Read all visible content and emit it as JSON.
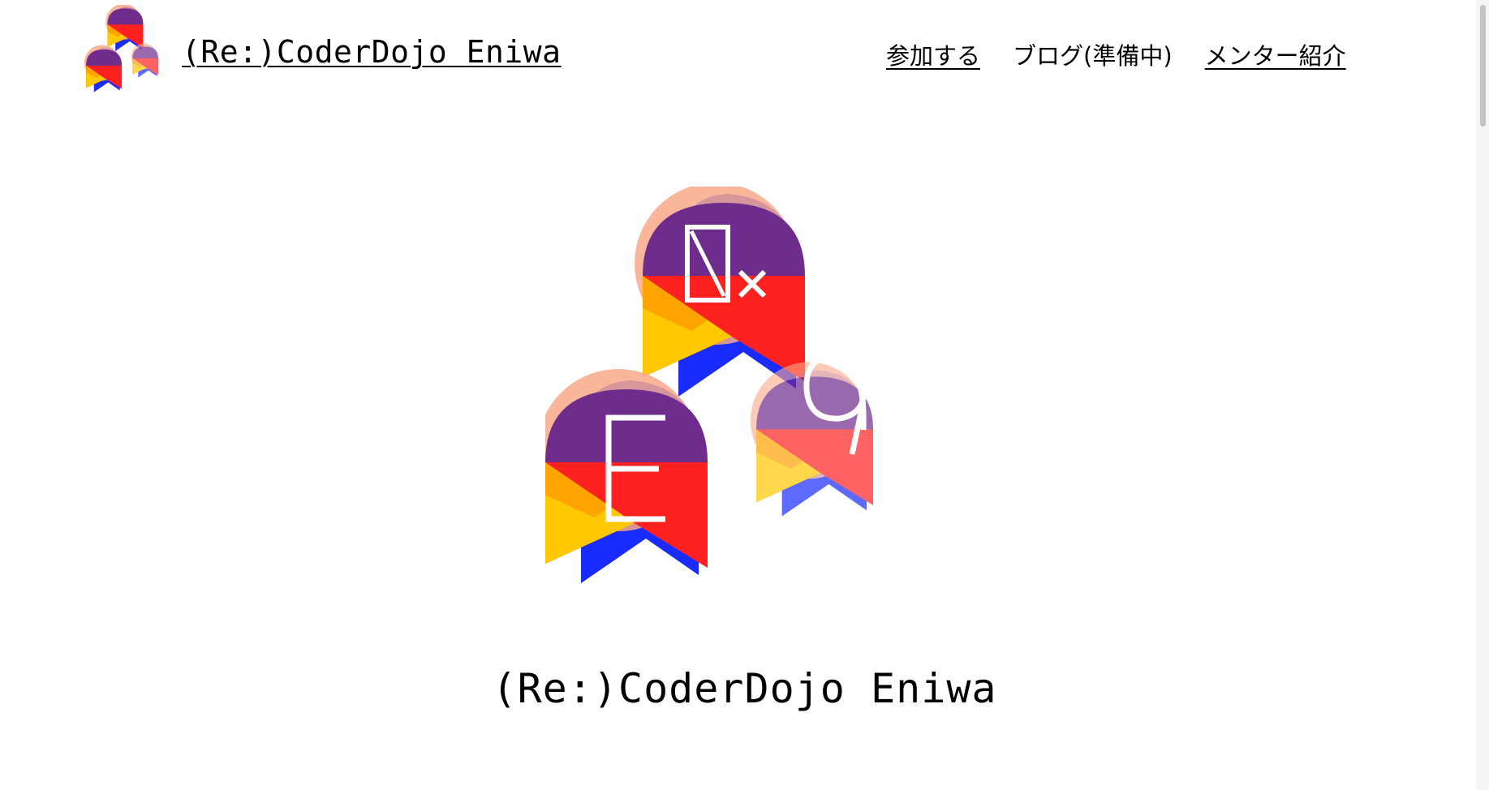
{
  "site": {
    "title": "(Re:)CoderDojo Eniwa",
    "logo_glyphs": {
      "top": "⊿×",
      "left": "E",
      "right": "9"
    }
  },
  "nav": {
    "items": [
      {
        "label": "参加する",
        "linked": true
      },
      {
        "label": "ブログ(準備中)",
        "linked": false
      },
      {
        "label": "メンター紹介",
        "linked": true
      }
    ]
  },
  "hero": {
    "title": "(Re:)CoderDojo Eniwa"
  },
  "colors": {
    "purple": "#6e2d8c",
    "salmon": "#f9a98a",
    "red": "#ff2020",
    "yellow": "#ffc800",
    "blue": "#1a2bff",
    "white": "#ffffff"
  }
}
